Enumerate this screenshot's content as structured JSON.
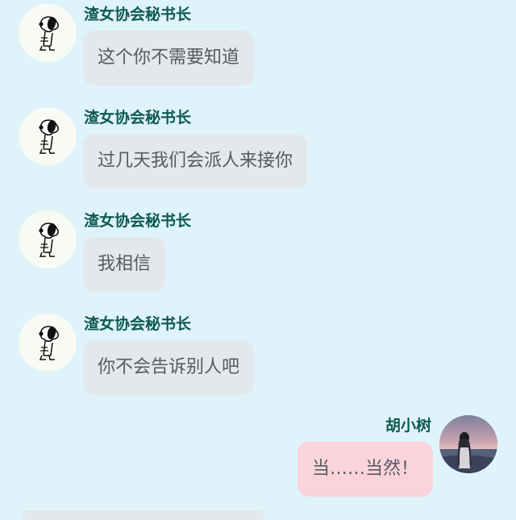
{
  "messages": [
    {
      "sender": "渣女协会秘书长",
      "text": "这个你不需要知道",
      "side": "left",
      "avatar_icon": "snoopy-avatar-icon"
    },
    {
      "sender": "渣女协会秘书长",
      "text": "过几天我们会派人来接你",
      "side": "left",
      "avatar_icon": "snoopy-avatar-icon"
    },
    {
      "sender": "渣女协会秘书长",
      "text": "我相信",
      "side": "left",
      "avatar_icon": "snoopy-avatar-icon"
    },
    {
      "sender": "渣女协会秘书长",
      "text": "你不会告诉别人吧",
      "side": "left",
      "avatar_icon": "snoopy-avatar-icon"
    },
    {
      "sender": "胡小树",
      "text": "当……当然！",
      "side": "right",
      "avatar_icon": "seaside-girl-avatar-icon"
    }
  ],
  "colors": {
    "background": "#dff3fb",
    "sender_name": "#0f5a4f",
    "bubble_left": "#e4e7ec",
    "bubble_right": "#fbd3da",
    "message_text": "#555b62"
  }
}
